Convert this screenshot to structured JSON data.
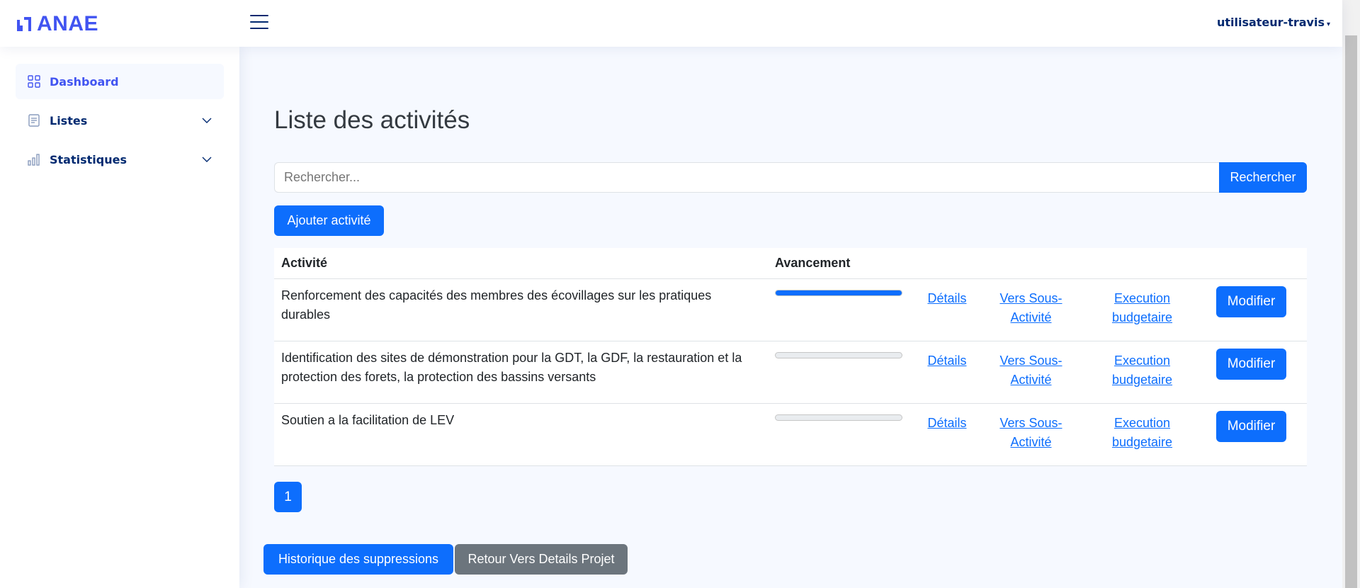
{
  "header": {
    "logo_text": "ANAE",
    "user_name": "utilisateur-travis"
  },
  "sidebar": {
    "items": [
      {
        "label": "Dashboard",
        "icon": "grid-icon",
        "active": true
      },
      {
        "label": "Listes",
        "icon": "list-icon",
        "expandable": true
      },
      {
        "label": "Statistiques",
        "icon": "bar-chart-icon",
        "expandable": true
      }
    ]
  },
  "main": {
    "title": "Liste des activités",
    "search": {
      "placeholder": "Rechercher...",
      "button_label": "Rechercher"
    },
    "add_button_label": "Ajouter activité",
    "table": {
      "headers": [
        "Activité",
        "Avancement"
      ],
      "rows": [
        {
          "activity": "Renforcement des capacités des membres des écovillages sur les pratiques durables",
          "progress": 1.0,
          "details": "Détails",
          "vers": "Vers Sous-Activité",
          "exec": "Execution budgetaire",
          "modify": "Modifier"
        },
        {
          "activity": "Identification des sites de démonstration pour la GDT, la GDF, la restauration et la protection des forets, la protection des bassins versants",
          "progress": 0.0,
          "details": "Détails",
          "vers": "Vers Sous-Activité",
          "exec": "Execution budgetaire",
          "modify": "Modifier"
        },
        {
          "activity": "Soutien a la facilitation de LEV",
          "progress": 0.0,
          "details": "Détails",
          "vers": "Vers Sous-Activité",
          "exec": "Execution budgetaire",
          "modify": "Modifier"
        }
      ]
    },
    "pagination": {
      "current_page": "1"
    },
    "history_button_label": "Historique des suppressions",
    "return_button_label": "Retour Vers Details Projet"
  },
  "colors": {
    "primary": "#0d6efd",
    "brand": "#4154f1",
    "nav_text": "#012970",
    "secondary": "#6c757d"
  }
}
